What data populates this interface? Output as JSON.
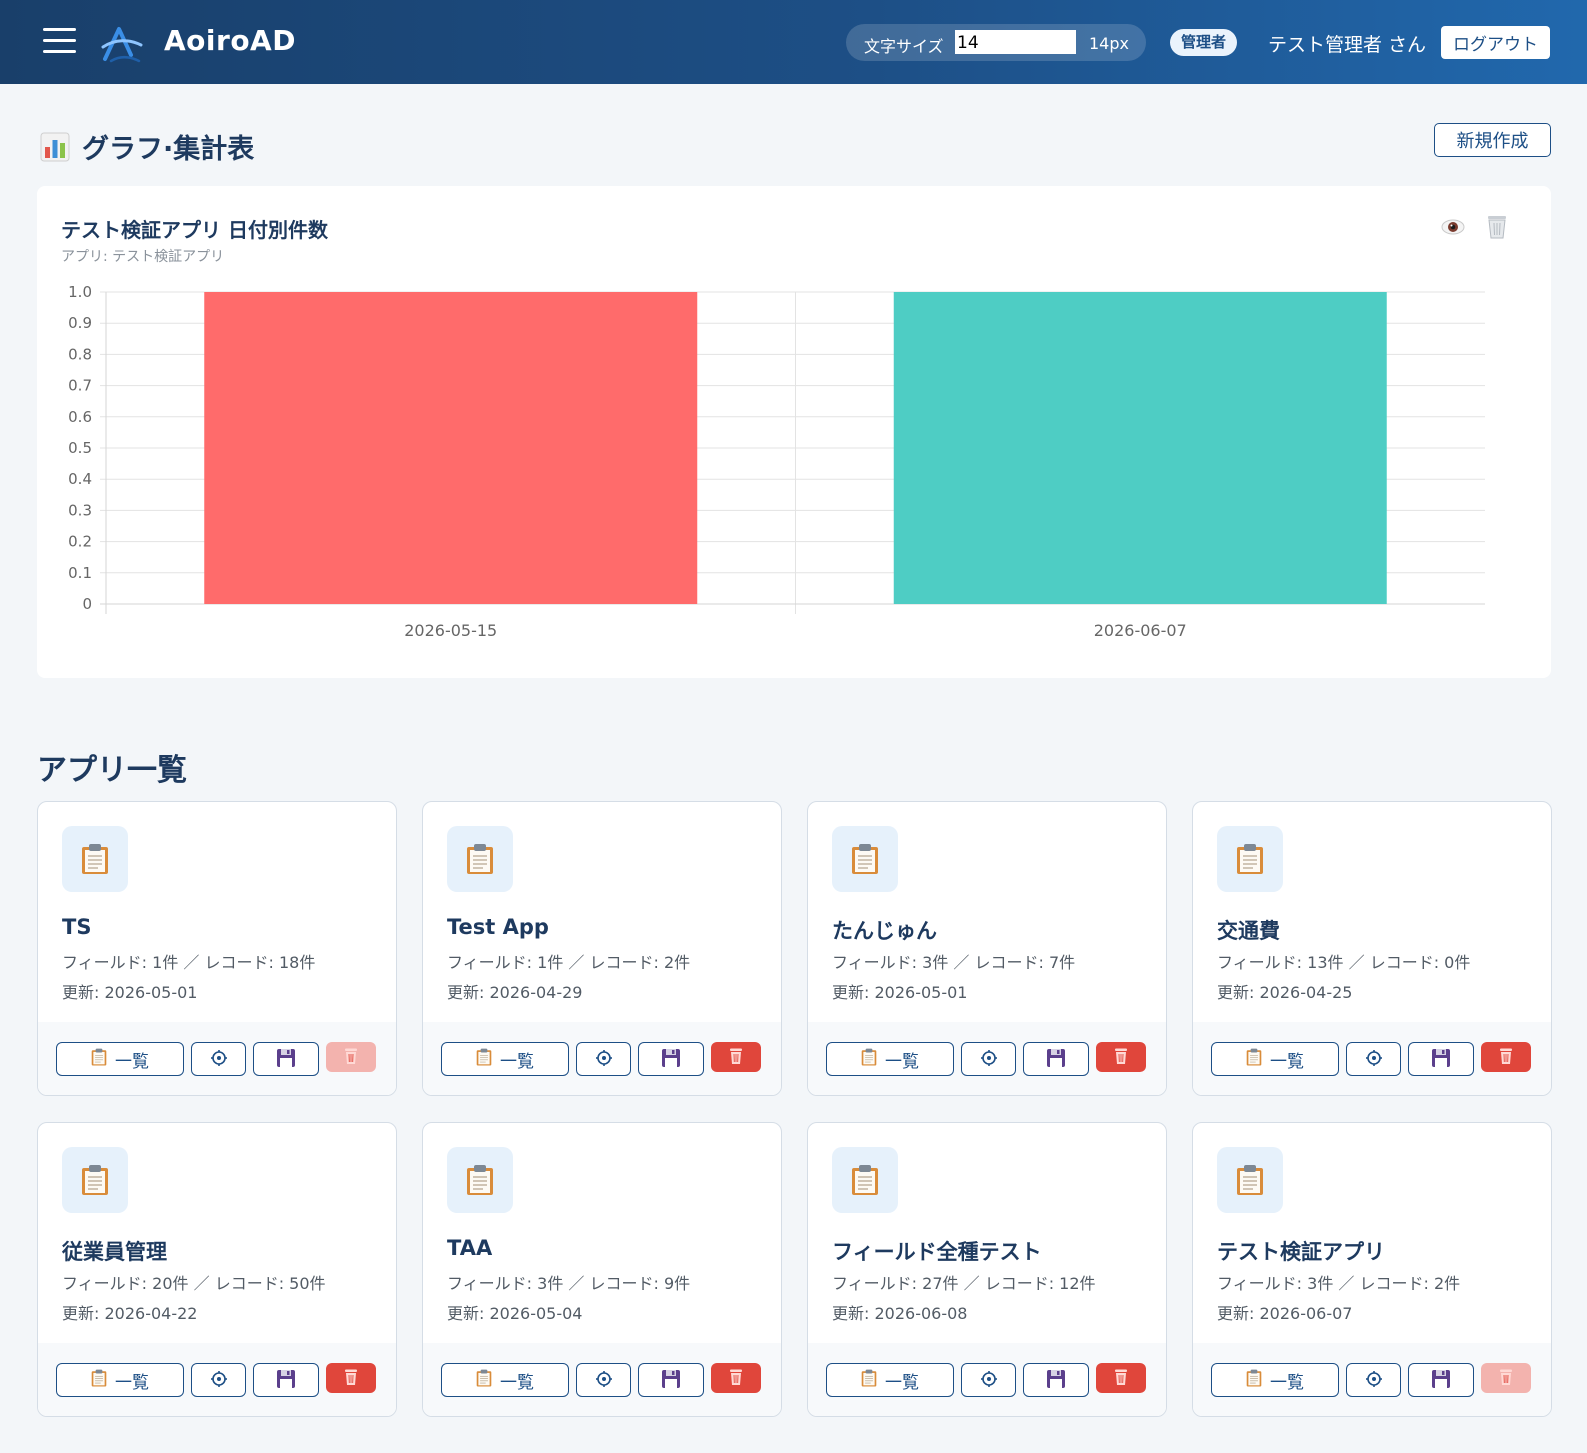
{
  "header": {
    "brand": "AoiroAD",
    "font_size_label": "文字サイズ",
    "font_size_input_value": "14",
    "font_size_display": "14px",
    "role_badge": "管理者",
    "user_name": "テスト管理者 さん",
    "logout_label": "ログアウト"
  },
  "charts_section": {
    "heading": "グラフ·集計表",
    "new_button_label": "新規作成"
  },
  "chart_card": {
    "title": "テスト検証アプリ 日付別件数",
    "subtitle": "アプリ: テスト検証アプリ"
  },
  "chart_data": {
    "type": "bar",
    "title": "テスト検証アプリ 日付別件数",
    "categories": [
      "2026-05-15",
      "2026-06-07"
    ],
    "values": [
      1,
      1
    ],
    "bar_colors": [
      "#ff6b6b",
      "#4ecdc4"
    ],
    "ylim": [
      0,
      1
    ],
    "y_ticks": [
      "0",
      "0.1",
      "0.2",
      "0.3",
      "0.4",
      "0.5",
      "0.6",
      "0.7",
      "0.8",
      "0.9",
      "1.0"
    ],
    "xlabel": "",
    "ylabel": "",
    "grid": true,
    "legend": "none"
  },
  "apps_section": {
    "heading": "アプリ一覧",
    "list_button_label": "一覧",
    "apps": [
      {
        "name": "TS",
        "meta": "フィールド: 1件 ／ レコード: 18件",
        "updated": "更新: 2026-05-01",
        "delete_enabled": false
      },
      {
        "name": "Test App",
        "meta": "フィールド: 1件 ／ レコード: 2件",
        "updated": "更新: 2026-04-29",
        "delete_enabled": true
      },
      {
        "name": "たんじゅん",
        "meta": "フィールド: 3件 ／ レコード: 7件",
        "updated": "更新: 2026-05-01",
        "delete_enabled": true
      },
      {
        "name": "交通費",
        "meta": "フィールド: 13件 ／ レコード: 0件",
        "updated": "更新: 2026-04-25",
        "delete_enabled": true
      },
      {
        "name": "従業員管理",
        "meta": "フィールド: 20件 ／ レコード: 50件",
        "updated": "更新: 2026-04-22",
        "delete_enabled": true
      },
      {
        "name": "TAA",
        "meta": "フィールド: 3件 ／ レコード: 9件",
        "updated": "更新: 2026-05-04",
        "delete_enabled": true
      },
      {
        "name": "フィールド全種テスト",
        "meta": "フィールド: 27件 ／ レコード: 12件",
        "updated": "更新: 2026-06-08",
        "delete_enabled": true
      },
      {
        "name": "テスト検証アプリ",
        "meta": "フィールド: 3件 ／ レコード: 2件",
        "updated": "更新: 2026-06-07",
        "delete_enabled": false
      }
    ]
  },
  "icons": {
    "menu": "hamburger-menu-icon",
    "logo": "aoiro-logo-icon",
    "chart": "bar-chart-icon",
    "view": "eye-icon",
    "delete_chart": "trash-icon",
    "app": "clipboard-icon",
    "settings": "gear-icon",
    "save": "floppy-disk-icon",
    "delete": "trash-icon"
  },
  "colors": {
    "header_start": "#193f6a",
    "header_end": "#2168ad",
    "accent": "#1d4f86",
    "delete": "#e0463b",
    "delete_disabled": "#f3b3ae"
  }
}
